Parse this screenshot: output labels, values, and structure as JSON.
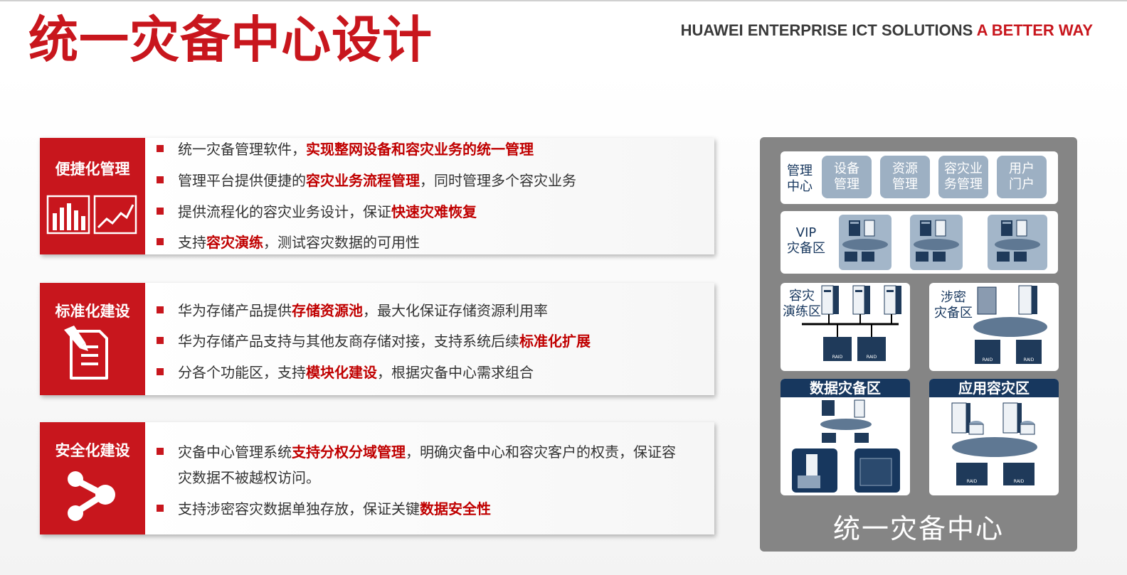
{
  "header": {
    "title": "统一灾备中心设计",
    "tagline_part1": "HUAWEI ENTERPRISE ICT SOLUTIONS",
    "tagline_part2": "A BETTER WAY"
  },
  "features": [
    {
      "title": "便捷化管理",
      "icon": "chart-icons",
      "bullets": [
        {
          "pre": "统一灾备管理软件，",
          "hl": "实现整网设备和容灾业务的统一管理",
          "post": ""
        },
        {
          "pre": "管理平台提供便捷的",
          "hl": "容灾业务流程管理",
          "post": "，同时管理多个容灾业务"
        },
        {
          "pre": "提供流程化的容灾业务设计，保证",
          "hl": "快速灾难恢复",
          "post": ""
        },
        {
          "pre": "支持",
          "hl": "容灾演练",
          "post": "，测试容灾数据的可用性"
        }
      ]
    },
    {
      "title": "标准化建设",
      "icon": "document-edit-icon",
      "bullets": [
        {
          "pre": "华为存储产品提供",
          "hl": "存储资源池",
          "post": "，最大化保证存储资源利用率"
        },
        {
          "pre": "华为存储产品支持与其他友商存储对接，支持系统后续",
          "hl": "标准化扩展",
          "post": ""
        },
        {
          "pre": "分各个功能区，支持",
          "hl": "模块化建设",
          "post": "，根据灾备中心需求组合"
        }
      ]
    },
    {
      "title": "安全化建设",
      "icon": "share-icon",
      "bullets": [
        {
          "pre": "灾备中心管理系统",
          "hl": "支持分权分域管理",
          "post": "，明确灾备中心和容灾客户的权责，保证容灾数据不被越权访问。"
        },
        {
          "pre": "支持涉密容灾数据单独存放，保证关键",
          "hl": "数据安全性",
          "post": ""
        }
      ]
    }
  ],
  "diagram": {
    "title": "统一灾备中心",
    "mgmt_label": "管理\n中心",
    "mgmt_items": [
      "设备\n管理",
      "资源\n管理",
      "容灾业\n务管理",
      "用户\n门户"
    ],
    "vip_label": "VIP\n灾备区",
    "drill_label": "容灾\n演练区",
    "secret_label": "涉密\n灾备区",
    "data_zone": "数据灾备区",
    "app_zone": "应用容灾区",
    "raid_text": "RAID"
  },
  "colors": {
    "accent_red": "#c8161d",
    "navy": "#17375e",
    "steel_blue": "#9db0c3",
    "diagram_gray": "#858585"
  }
}
